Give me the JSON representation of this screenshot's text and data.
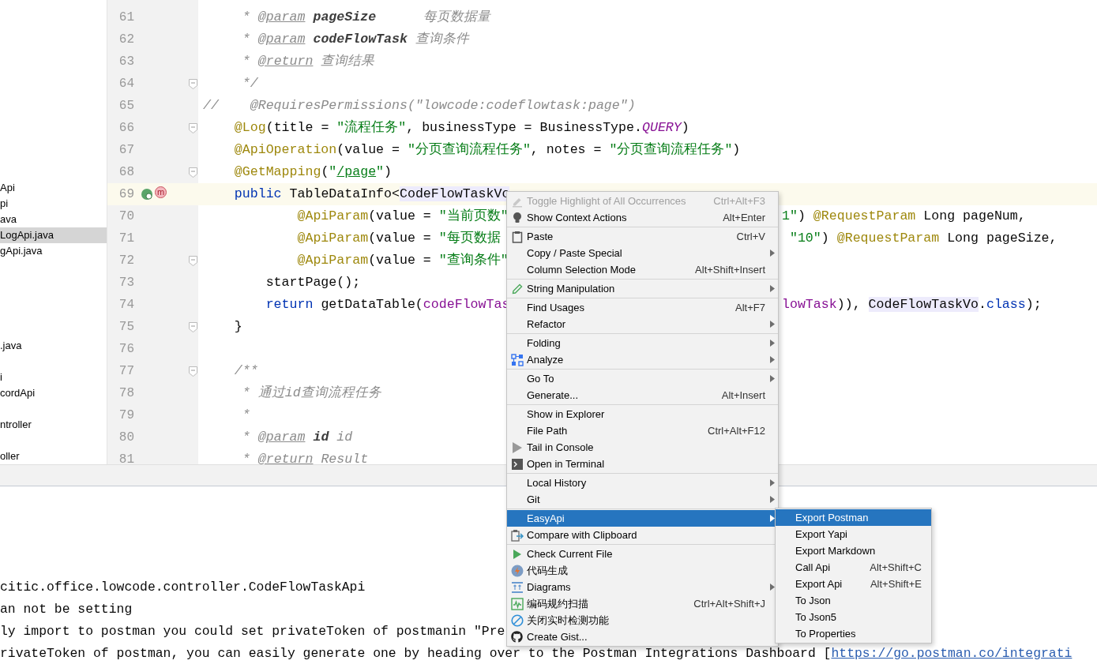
{
  "sidebar": {
    "items": [
      {
        "kind": "file",
        "label": "Api",
        "selected": false
      },
      {
        "kind": "file",
        "label": "pi",
        "selected": false
      },
      {
        "kind": "file",
        "label": "ava",
        "selected": false
      },
      {
        "kind": "file",
        "label": "LogApi.java",
        "selected": true
      },
      {
        "kind": "file",
        "label": "gApi.java",
        "selected": false
      },
      {
        "kind": "blank"
      },
      {
        "kind": "blank"
      },
      {
        "kind": "blank"
      },
      {
        "kind": "blank"
      },
      {
        "kind": "blank"
      },
      {
        "kind": "file",
        "label": ".java",
        "selected": false
      },
      {
        "kind": "blank"
      },
      {
        "kind": "file",
        "label": "i",
        "selected": false
      },
      {
        "kind": "file",
        "label": "cordApi",
        "selected": false
      },
      {
        "kind": "blank"
      },
      {
        "kind": "file",
        "label": "ntroller",
        "selected": false
      },
      {
        "kind": "blank"
      },
      {
        "kind": "file",
        "label": "oller",
        "selected": false
      }
    ]
  },
  "editor": {
    "lines": [
      {
        "number": "61",
        "fold": false,
        "current": false,
        "code": [
          {
            "kind": "comment",
            "text": "     * "
          },
          {
            "kind": "doctag",
            "text": "@param"
          },
          {
            "kind": "docparam",
            "text": " pageSize"
          },
          {
            "kind": "comment",
            "text": "      每页数据量"
          }
        ]
      },
      {
        "number": "62",
        "fold": false,
        "current": false,
        "code": [
          {
            "kind": "comment",
            "text": "     * "
          },
          {
            "kind": "doctag",
            "text": "@param"
          },
          {
            "kind": "docparam",
            "text": " codeFlowTask"
          },
          {
            "kind": "comment",
            "text": " 查询条件"
          }
        ]
      },
      {
        "number": "63",
        "fold": false,
        "current": false,
        "code": [
          {
            "kind": "comment",
            "text": "     * "
          },
          {
            "kind": "doctag",
            "text": "@return"
          },
          {
            "kind": "comment",
            "text": " 查询结果"
          }
        ]
      },
      {
        "number": "64",
        "fold": true,
        "current": false,
        "code": [
          {
            "kind": "comment",
            "text": "     */"
          }
        ]
      },
      {
        "number": "65",
        "fold": false,
        "current": false,
        "code": [
          {
            "kind": "linecomment",
            "text": "//    @RequiresPermissions(\"lowcode:codeflowtask:page\")"
          }
        ]
      },
      {
        "number": "66",
        "fold": true,
        "current": false,
        "code": [
          {
            "kind": "annotation",
            "text": "    @Log"
          },
          {
            "kind": "plain",
            "text": "(title = "
          },
          {
            "kind": "string",
            "text": "\"流程任务\""
          },
          {
            "kind": "plain",
            "text": ", businessType = BusinessType."
          },
          {
            "kind": "constant",
            "text": "QUERY"
          },
          {
            "kind": "plain",
            "text": ")"
          }
        ]
      },
      {
        "number": "67",
        "fold": false,
        "current": false,
        "code": [
          {
            "kind": "annotation",
            "text": "    @ApiOperation"
          },
          {
            "kind": "plain",
            "text": "(value = "
          },
          {
            "kind": "string",
            "text": "\"分页查询流程任务\""
          },
          {
            "kind": "plain",
            "text": ", notes = "
          },
          {
            "kind": "string",
            "text": "\"分页查询流程任务\""
          },
          {
            "kind": "plain",
            "text": ")"
          }
        ]
      },
      {
        "number": "68",
        "fold": true,
        "current": false,
        "code": [
          {
            "kind": "annotation",
            "text": "    @GetMapping"
          },
          {
            "kind": "plain",
            "text": "("
          },
          {
            "kind": "string",
            "text": "\""
          },
          {
            "kind": "link",
            "text": "/page"
          },
          {
            "kind": "string",
            "text": "\""
          },
          {
            "kind": "plain",
            "text": ")"
          }
        ]
      },
      {
        "number": "69",
        "fold": false,
        "current": true,
        "markers": [
          {
            "kind": "implemented"
          },
          {
            "kind": "method",
            "label": "m"
          }
        ],
        "code": [
          {
            "kind": "keyword",
            "text": "    public"
          },
          {
            "kind": "plain",
            "text": " TableDataInfo<"
          },
          {
            "kind": "highlight",
            "text": "CodeFlowTaskVo"
          }
        ]
      },
      {
        "number": "70",
        "fold": false,
        "current": false,
        "code": [
          {
            "kind": "annotation",
            "text": "            @ApiParam"
          },
          {
            "kind": "plain",
            "text": "(value = "
          },
          {
            "kind": "string",
            "text": "\"当前页数\""
          }
        ],
        "right": [
          {
            "kind": "string",
            "text": "1\""
          },
          {
            "kind": "plain",
            "text": ") "
          },
          {
            "kind": "annotation",
            "text": "@RequestParam"
          },
          {
            "kind": "plain",
            "text": " Long pageNum,"
          }
        ]
      },
      {
        "number": "71",
        "fold": false,
        "current": false,
        "code": [
          {
            "kind": "annotation",
            "text": "            @ApiParam"
          },
          {
            "kind": "plain",
            "text": "(value = "
          },
          {
            "kind": "string",
            "text": "\"每页数据"
          }
        ],
        "right": [
          {
            "kind": "string",
            "text": " \"10\""
          },
          {
            "kind": "plain",
            "text": ") "
          },
          {
            "kind": "annotation",
            "text": "@RequestParam"
          },
          {
            "kind": "plain",
            "text": " Long pageSize,"
          }
        ]
      },
      {
        "number": "72",
        "fold": true,
        "current": false,
        "code": [
          {
            "kind": "annotation",
            "text": "            @ApiParam"
          },
          {
            "kind": "plain",
            "text": "(value = "
          },
          {
            "kind": "string",
            "text": "\"查询条件\""
          }
        ]
      },
      {
        "number": "73",
        "fold": false,
        "current": false,
        "code": [
          {
            "kind": "plain",
            "text": "        startPage();"
          }
        ]
      },
      {
        "number": "74",
        "fold": false,
        "current": false,
        "code": [
          {
            "kind": "keyword",
            "text": "        return"
          },
          {
            "kind": "plain",
            "text": " getDataTable("
          },
          {
            "kind": "field",
            "text": "codeFlowTas"
          }
        ],
        "right": [
          {
            "kind": "field",
            "text": "lowTask"
          },
          {
            "kind": "plain",
            "text": ")), "
          },
          {
            "kind": "highlight",
            "text": "CodeFlowTaskVo"
          },
          {
            "kind": "plain",
            "text": "."
          },
          {
            "kind": "keyword",
            "text": "class"
          },
          {
            "kind": "plain",
            "text": ");"
          }
        ]
      },
      {
        "number": "75",
        "fold": true,
        "current": false,
        "code": [
          {
            "kind": "plain",
            "text": "    }"
          }
        ]
      },
      {
        "number": "76",
        "fold": false,
        "current": false
      },
      {
        "number": "77",
        "fold": true,
        "current": false,
        "code": [
          {
            "kind": "comment",
            "text": "    /**"
          }
        ]
      },
      {
        "number": "78",
        "fold": false,
        "current": false,
        "code": [
          {
            "kind": "comment",
            "text": "     * 通过id查询流程任务"
          }
        ]
      },
      {
        "number": "79",
        "fold": false,
        "current": false,
        "code": [
          {
            "kind": "comment",
            "text": "     *"
          }
        ]
      },
      {
        "number": "80",
        "fold": false,
        "current": false,
        "code": [
          {
            "kind": "comment",
            "text": "     * "
          },
          {
            "kind": "doctag",
            "text": "@param"
          },
          {
            "kind": "docparam",
            "text": " id"
          },
          {
            "kind": "comment",
            "text": " id"
          }
        ]
      },
      {
        "number": "81",
        "fold": false,
        "current": false,
        "code": [
          {
            "kind": "comment",
            "text": "     * "
          },
          {
            "kind": "doctag",
            "text": "@return"
          },
          {
            "kind": "comment",
            "text": " Result"
          }
        ]
      }
    ]
  },
  "console": {
    "lines": [
      {
        "text": "citic.office.lowcode.controller.CodeFlowTaskApi"
      },
      {
        "text": "an not be setting"
      },
      {
        "text": "ly import to postman you could set privateToken of postmanin \"Pre"
      },
      {
        "text": "rivateToken of postman, you can easily generate one by heading over to the Postman Integrations Dashboard [",
        "link": "https://go.postman.co/integrati"
      }
    ]
  },
  "context_menu": {
    "groups": [
      [
        {
          "label": "Toggle Highlight of All Occurrences",
          "shortcut": "Ctrl+Alt+F3",
          "kind": "highlighter",
          "submenu": false,
          "disabled": true,
          "selected": false
        },
        {
          "label": "Show Context Actions",
          "shortcut": "Alt+Enter",
          "kind": "bulb",
          "submenu": false,
          "disabled": false,
          "selected": false
        }
      ],
      [
        {
          "label": "Paste",
          "shortcut": "Ctrl+V",
          "kind": "clipboard",
          "submenu": false,
          "disabled": false,
          "selected": false
        },
        {
          "label": "Copy / Paste Special",
          "submenu": true,
          "disabled": false,
          "selected": false
        },
        {
          "label": "Column Selection Mode",
          "shortcut": "Alt+Shift+Insert",
          "submenu": false,
          "disabled": false,
          "selected": false
        }
      ],
      [
        {
          "label": "String Manipulation",
          "kind": "pencil",
          "submenu": true,
          "disabled": false,
          "selected": false
        }
      ],
      [
        {
          "label": "Find Usages",
          "shortcut": "Alt+F7",
          "submenu": false,
          "disabled": false,
          "selected": false
        },
        {
          "label": "Refactor",
          "submenu": true,
          "disabled": false,
          "selected": false
        }
      ],
      [
        {
          "label": "Folding",
          "submenu": true,
          "disabled": false,
          "selected": false
        },
        {
          "label": "Analyze",
          "kind": "analyze",
          "submenu": true,
          "disabled": false,
          "selected": false
        }
      ],
      [
        {
          "label": "Go To",
          "submenu": true,
          "disabled": false,
          "selected": false
        },
        {
          "label": "Generate...",
          "shortcut": "Alt+Insert",
          "submenu": false,
          "disabled": false,
          "selected": false
        }
      ],
      [
        {
          "label": "Show in Explorer",
          "submenu": false,
          "disabled": false,
          "selected": false
        },
        {
          "label": "File Path",
          "shortcut": "Ctrl+Alt+F12",
          "submenu": false,
          "disabled": false,
          "selected": false
        },
        {
          "label": "Tail in Console",
          "kind": "tail",
          "submenu": false,
          "disabled": false,
          "selected": false
        },
        {
          "label": "Open in Terminal",
          "kind": "terminal",
          "submenu": false,
          "disabled": false,
          "selected": false
        }
      ],
      [
        {
          "label": "Local History",
          "submenu": true,
          "disabled": false,
          "selected": false
        },
        {
          "label": "Git",
          "submenu": true,
          "disabled": false,
          "selected": false
        }
      ],
      [
        {
          "label": "EasyApi",
          "submenu": true,
          "disabled": false,
          "selected": true
        },
        {
          "label": "Compare with Clipboard",
          "kind": "compare",
          "submenu": false,
          "disabled": false,
          "selected": false
        }
      ],
      [
        {
          "label": "Check Current File",
          "kind": "check",
          "submenu": false,
          "disabled": false,
          "selected": false
        },
        {
          "label": "代码生成",
          "kind": "codegen",
          "submenu": false,
          "disabled": false,
          "selected": false
        },
        {
          "label": "Diagrams",
          "kind": "diagram",
          "submenu": true,
          "disabled": false,
          "selected": false
        },
        {
          "label": "编码规约扫描",
          "shortcut": "Ctrl+Alt+Shift+J",
          "kind": "scan",
          "submenu": false,
          "disabled": false,
          "selected": false
        },
        {
          "label": "关闭实时检测功能",
          "kind": "forbid",
          "submenu": false,
          "disabled": false,
          "selected": false
        },
        {
          "label": "Create Gist...",
          "kind": "github",
          "submenu": false,
          "disabled": false,
          "selected": false
        }
      ]
    ]
  },
  "submenu": {
    "items": [
      {
        "label": "Export Postman",
        "selected": true
      },
      {
        "label": "Export Yapi",
        "selected": false
      },
      {
        "label": "Export Markdown",
        "selected": false
      },
      {
        "label": "Call Api",
        "shortcut": "Alt+Shift+C",
        "selected": false
      },
      {
        "label": "Export Api",
        "shortcut": "Alt+Shift+E",
        "selected": false
      },
      {
        "label": "To Json",
        "selected": false
      },
      {
        "label": "To Json5",
        "selected": false
      },
      {
        "label": "To Properties",
        "selected": false
      }
    ]
  }
}
